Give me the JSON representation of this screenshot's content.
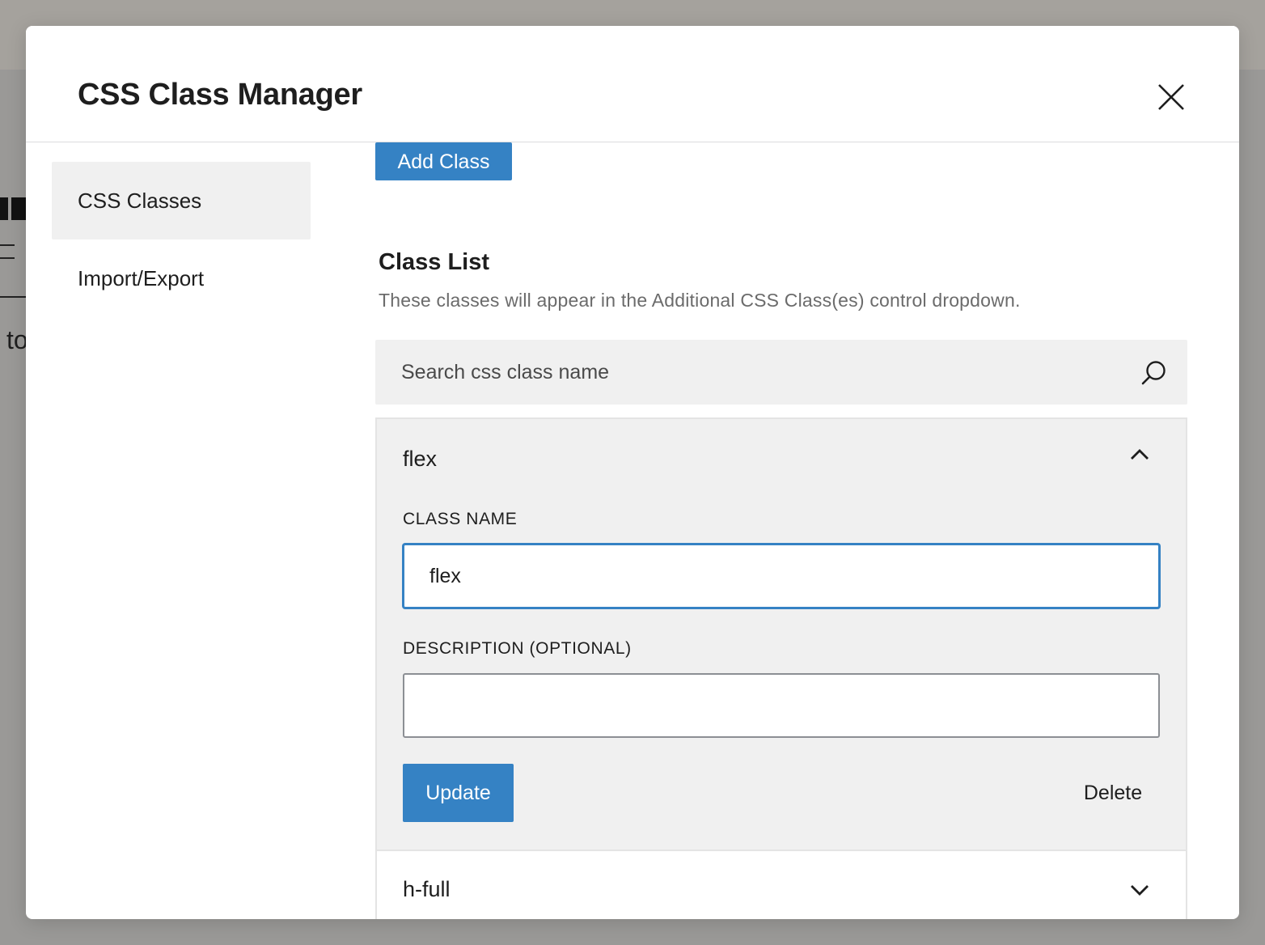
{
  "background": {
    "fragment_text": "to"
  },
  "modal": {
    "title": "CSS Class Manager",
    "close_icon": "close-icon"
  },
  "sidebar": {
    "items": [
      {
        "label": "CSS Classes",
        "active": true
      },
      {
        "label": "Import/Export",
        "active": false
      }
    ]
  },
  "content": {
    "add_button_label": "Add Class",
    "class_list_title": "Class List",
    "class_list_description": "These classes will appear in the Additional CSS Class(es) control dropdown.",
    "search": {
      "placeholder": "Search css class name",
      "value": "",
      "icon": "search-icon"
    },
    "classes": [
      {
        "name": "flex",
        "expanded": true,
        "class_name_label": "CLASS NAME",
        "class_name_value": "flex",
        "description_label": "DESCRIPTION (OPTIONAL)",
        "description_value": "",
        "update_label": "Update",
        "delete_label": "Delete"
      },
      {
        "name": "h-full",
        "expanded": false
      }
    ]
  },
  "colors": {
    "accent": "#3582c4",
    "panel_bg": "#f0f0f0",
    "text": "#1e1e1e",
    "muted_text": "#6b6b6b",
    "overlay": "#a3a19d"
  }
}
